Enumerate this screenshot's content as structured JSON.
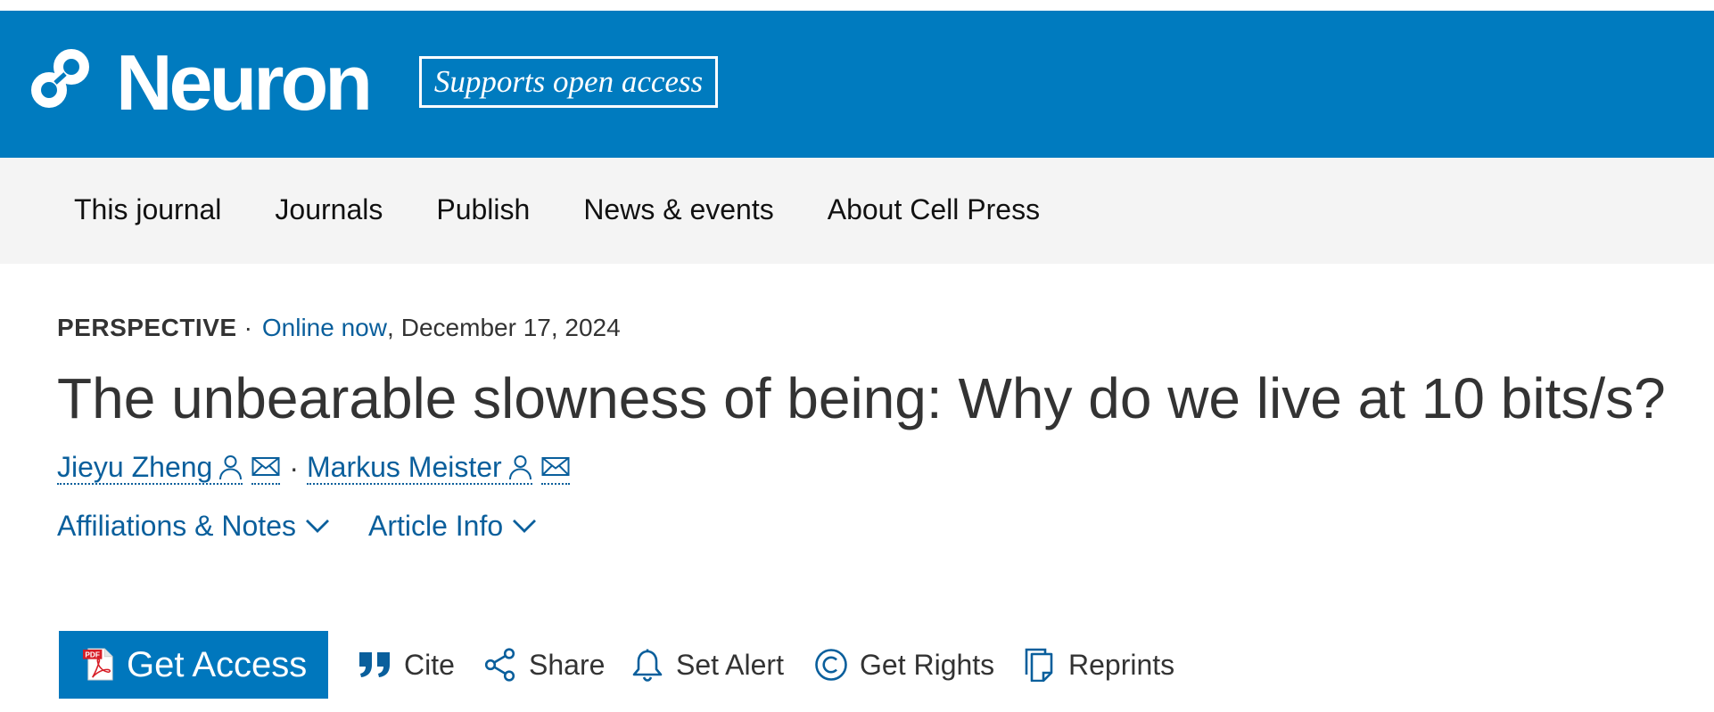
{
  "colors": {
    "header_bg": "#007bbf",
    "nav_bg": "#f4f4f4",
    "link": "#0a5f9c",
    "button_bg": "#0077bd",
    "text": "#333333",
    "nav_text": "#111111",
    "pdf_red": "#d71e27"
  },
  "header": {
    "logo_icon": "neuron-logo-icon",
    "journal_name": "Neuron",
    "open_access_badge": "Supports open access"
  },
  "nav": {
    "items": [
      {
        "label": "This journal"
      },
      {
        "label": "Journals"
      },
      {
        "label": "Publish"
      },
      {
        "label": "News & events"
      },
      {
        "label": "About Cell Press"
      }
    ]
  },
  "article": {
    "type": "PERSPECTIVE",
    "meta_separator": "·",
    "status": "Online now",
    "date_separator": ",",
    "date": "December 17, 2024",
    "title": "The unbearable slowness of being: Why do we live at 10 bits/s?",
    "authors": [
      {
        "name": "Jieyu Zheng",
        "icons": [
          "person-icon",
          "envelope-icon"
        ]
      },
      {
        "name": "Markus Meister",
        "icons": [
          "person-icon",
          "envelope-icon"
        ]
      }
    ],
    "author_separator": "·",
    "expanders": [
      {
        "label": "Affiliations & Notes",
        "icon": "chevron-down-icon"
      },
      {
        "label": "Article Info",
        "icon": "chevron-down-icon"
      }
    ]
  },
  "toolbar": {
    "get_access": {
      "label": "Get Access",
      "icon": "pdf-icon",
      "icon_label": "PDF"
    },
    "actions": [
      {
        "label": "Cite",
        "icon": "quote-icon"
      },
      {
        "label": "Share",
        "icon": "share-icon"
      },
      {
        "label": "Set Alert",
        "icon": "bell-icon"
      },
      {
        "label": "Get Rights",
        "icon": "copyright-icon"
      },
      {
        "label": "Reprints",
        "icon": "reprints-icon"
      }
    ]
  }
}
